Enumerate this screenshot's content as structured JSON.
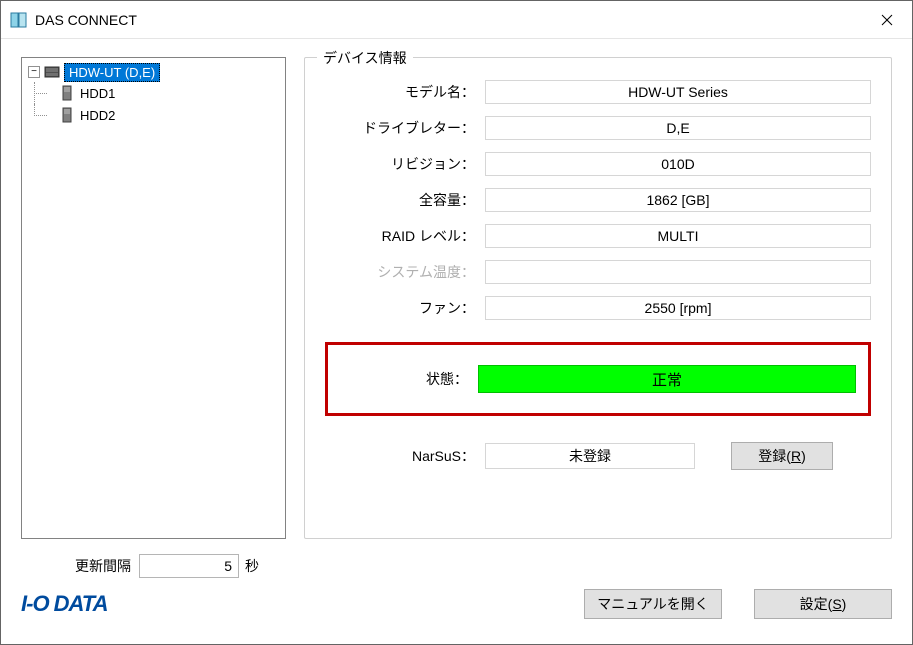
{
  "window": {
    "title": "DAS CONNECT"
  },
  "tree": {
    "root_label": "HDW-UT (D,E)",
    "children": [
      {
        "label": "HDD1"
      },
      {
        "label": "HDD2"
      }
    ]
  },
  "device_info": {
    "group_title": "デバイス情報",
    "rows": {
      "model_label": "モデル名：",
      "model_value": "HDW-UT Series",
      "drive_letter_label": "ドライブレター：",
      "drive_letter_value": "D,E",
      "revision_label": "リビジョン：",
      "revision_value": "010D",
      "capacity_label": "全容量：",
      "capacity_value": "1862 [GB]",
      "raid_label": "RAID レベル：",
      "raid_value": "MULTI",
      "temp_label": "システム温度：",
      "temp_value": "",
      "fan_label": "ファン：",
      "fan_value": "2550 [rpm]"
    },
    "status": {
      "label": "状態：",
      "value": "正常"
    },
    "narsus": {
      "label": "NarSuS：",
      "value": "未登録",
      "register_button": "登録(R)"
    }
  },
  "refresh": {
    "label": "更新間隔",
    "value": "5",
    "unit": "秒"
  },
  "footer": {
    "logo": "I‑O DATA",
    "manual_button": "マニュアルを開く",
    "settings_button": "設定(S)"
  }
}
